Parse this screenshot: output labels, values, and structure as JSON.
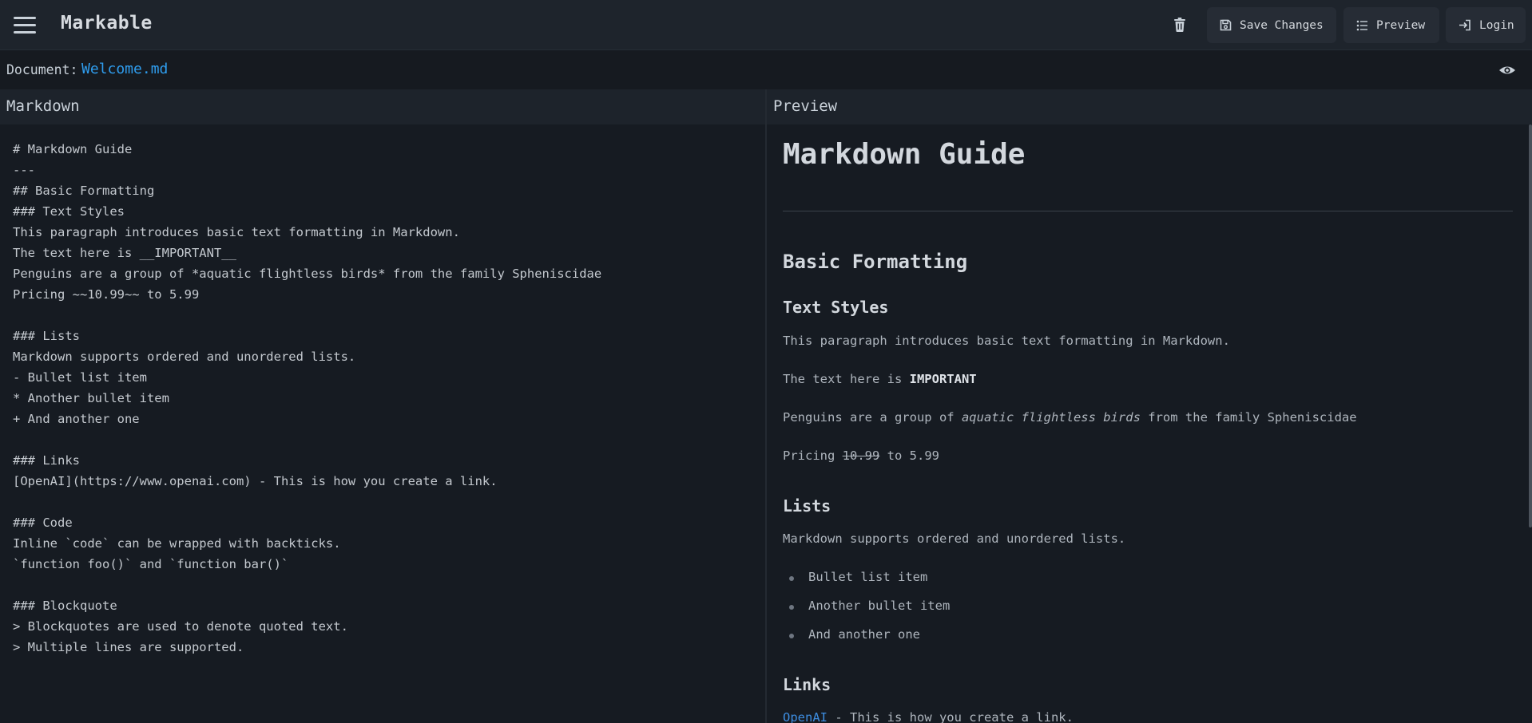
{
  "app": {
    "title": "Markable"
  },
  "toolbar": {
    "save_label": "Save Changes",
    "preview_label": "Preview",
    "login_label": "Login"
  },
  "document": {
    "label": "Document:",
    "name": "Welcome.md"
  },
  "panels": {
    "markdown_title": "Markdown",
    "preview_title": "Preview"
  },
  "editor": {
    "content": "# Markdown Guide\n---\n## Basic Formatting\n### Text Styles\nThis paragraph introduces basic text formatting in Markdown.\nThe text here is __IMPORTANT__\nPenguins are a group of *aquatic flightless birds* from the family Spheniscidae\nPricing ~~10.99~~ to 5.99\n\n### Lists\nMarkdown supports ordered and unordered lists.\n- Bullet list item\n* Another bullet item\n+ And another one\n\n### Links\n[OpenAI](https://www.openai.com) - This is how you create a link.\n\n### Code\nInline `code` can be wrapped with backticks.\n`function foo()` and `function bar()`\n\n### Blockquote\n> Blockquotes are used to denote quoted text.\n> Multiple lines are supported."
  },
  "preview": {
    "h1": "Markdown Guide",
    "h2_basic": "Basic Formatting",
    "h3_text_styles": "Text Styles",
    "p1": "This paragraph introduces basic text formatting in Markdown.",
    "p2_pre": "The text here is ",
    "p2_bold": "IMPORTANT",
    "p3_pre": "Penguins are a group of ",
    "p3_italic": "aquatic flightless birds",
    "p3_post": " from the family Spheniscidae",
    "p4_pre": "Pricing ",
    "p4_strike": "10.99",
    "p4_post": " to 5.99",
    "h3_lists": "Lists",
    "lists_intro": "Markdown supports ordered and unordered lists.",
    "list_items": [
      "Bullet list item",
      "Another bullet item",
      "And another one"
    ],
    "h3_links": "Links",
    "link_text": "OpenAI",
    "link_post": " - This is how you create a link."
  },
  "icons": {
    "menu": "hamburger-menu-icon",
    "trash": "trash-icon",
    "save": "floppy-disk-icon",
    "preview": "list-icon",
    "login": "login-icon",
    "eye": "eye-icon"
  },
  "colors": {
    "background": "#161b22",
    "topbar": "#1e242c",
    "button": "#262c35",
    "link": "#2f9dee",
    "text": "#c9d1d9"
  }
}
